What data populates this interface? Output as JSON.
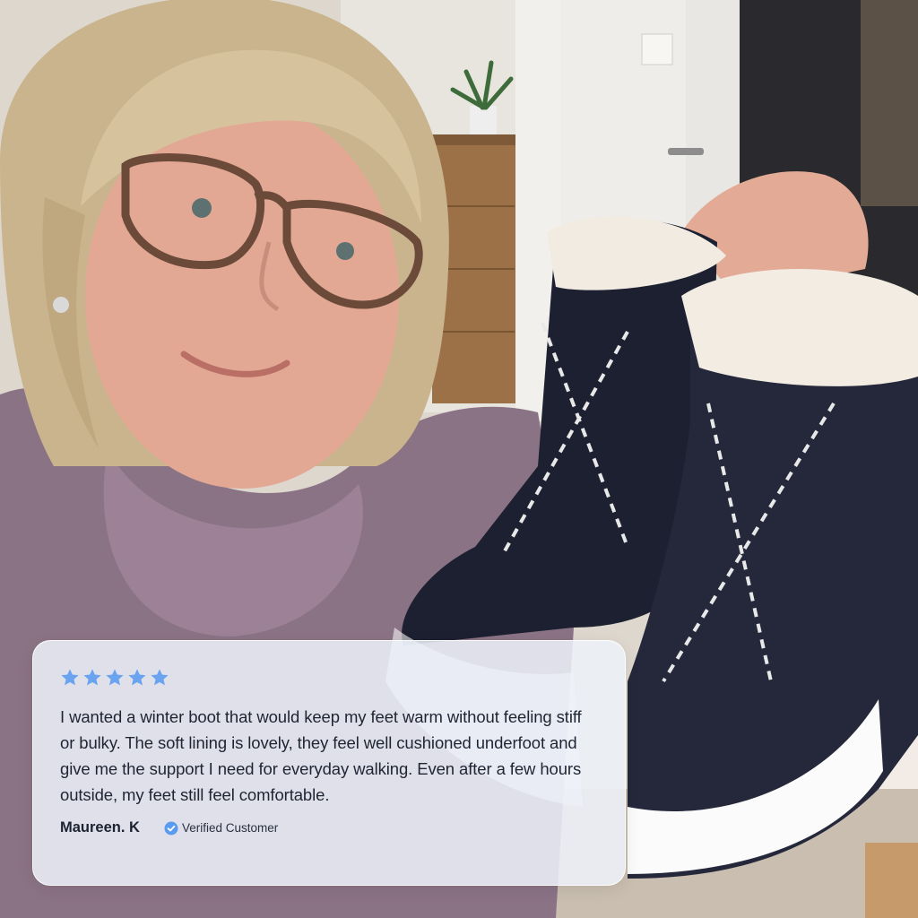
{
  "review": {
    "rating": 5,
    "rating_max": 5,
    "star_color": "#6aa3f0",
    "text": "I wanted a winter boot that would keep my feet warm without feeling stiff or bulky. The soft lining is lovely, they feel well cushioned underfoot and give me the support I need for everyday walking. Even after a few hours outside, my feet still feel comfortable.",
    "author": "Maureen. K",
    "badge_label": "Verified Customer",
    "badge_icon": "check-badge-icon",
    "badge_color": "#5b9bef"
  },
  "photo": {
    "subject": "woman-holding-winter-boots",
    "icons": [
      "woman",
      "glasses",
      "knit-sweater",
      "winter-boots",
      "door",
      "dresser",
      "plant"
    ]
  }
}
